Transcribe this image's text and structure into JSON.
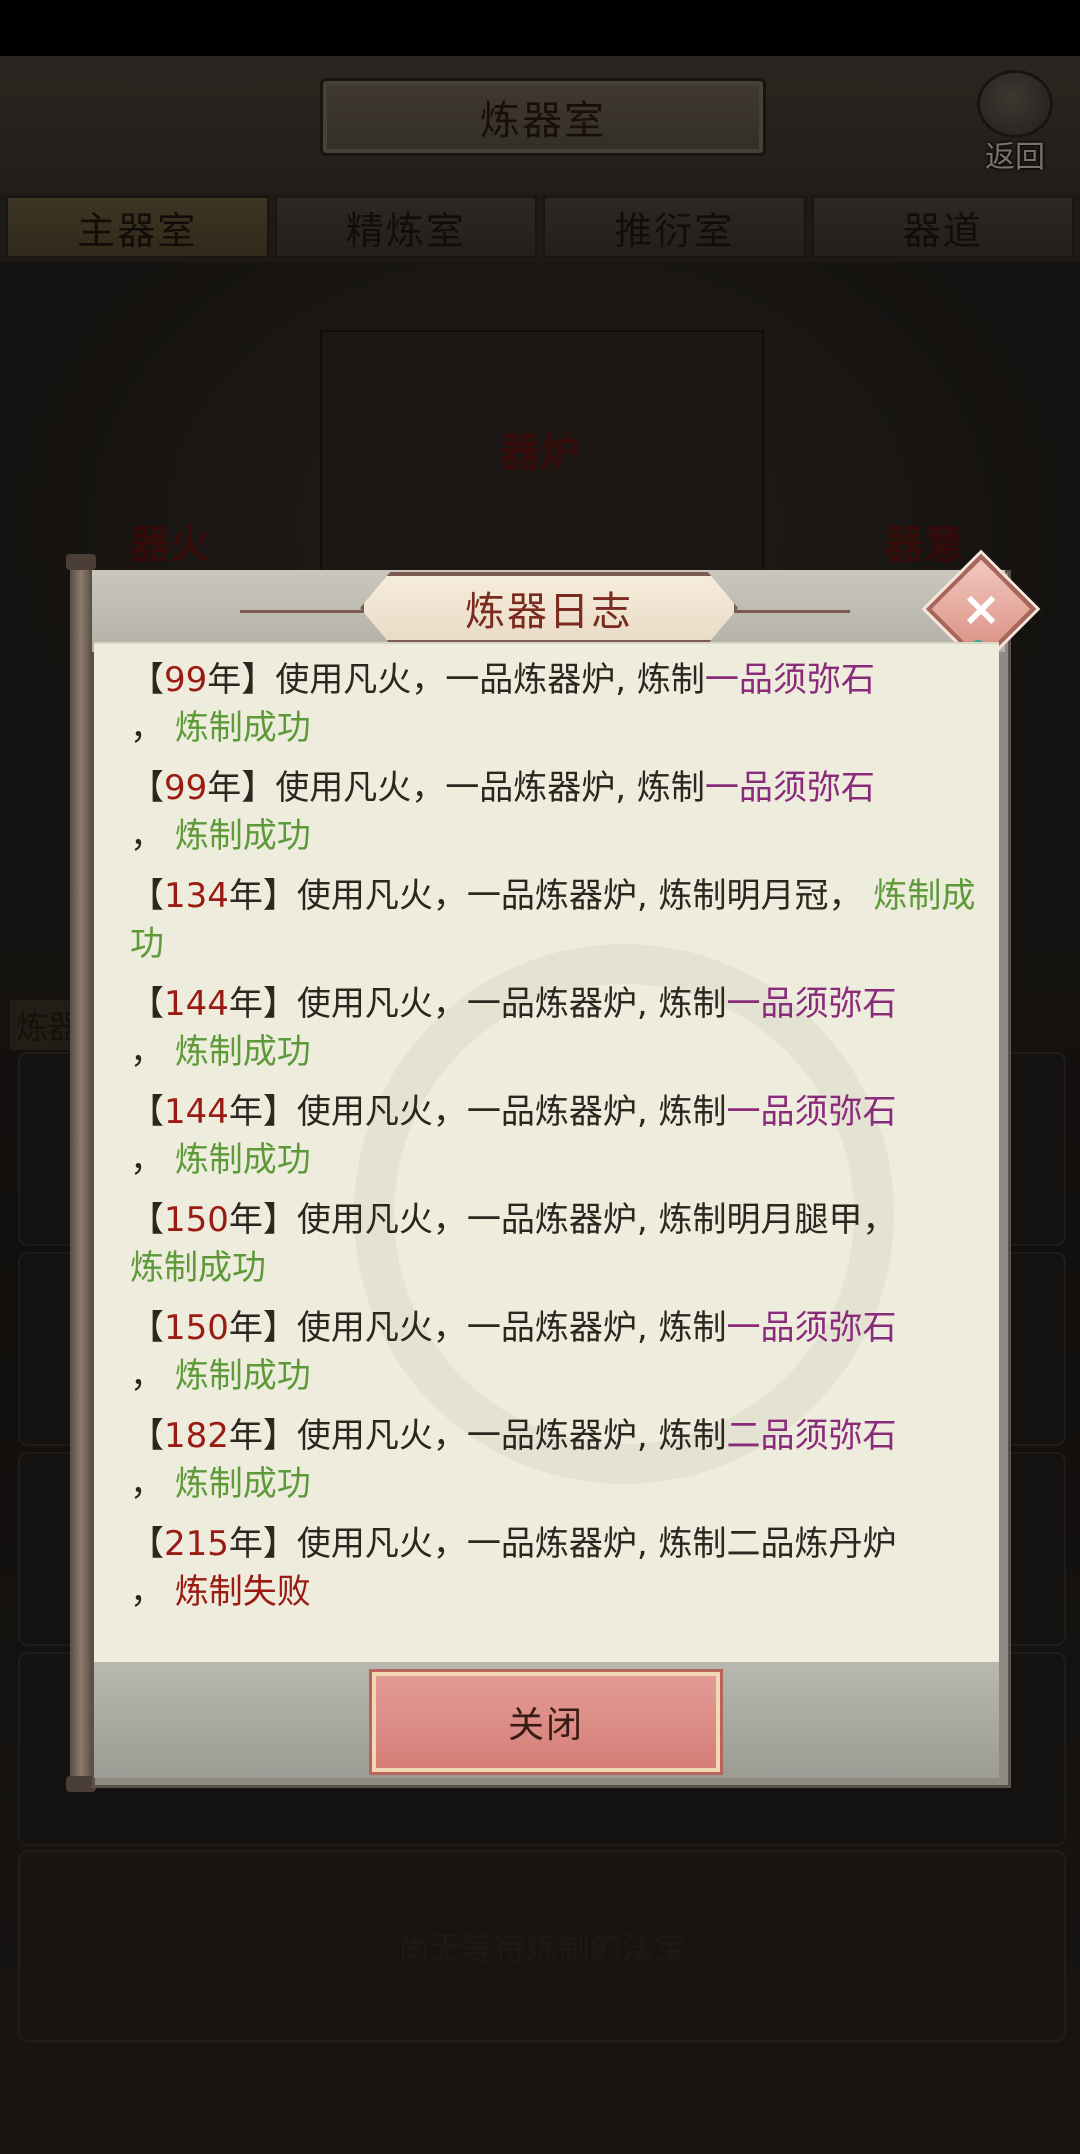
{
  "header": {
    "title": "炼器室",
    "back_label": "返回"
  },
  "tabs": [
    {
      "label": "主器室"
    },
    {
      "label": "精炼室"
    },
    {
      "label": "推衍室"
    },
    {
      "label": "器道"
    }
  ],
  "scene": {
    "furnace_label": "器炉",
    "fire_label": "器火",
    "side_label_right": "器意",
    "side_tab_label": "炼器",
    "empty_queue_text": "尚无等待炼制的法宝"
  },
  "dialog": {
    "title": "炼器日志",
    "close_button_label": "关闭",
    "entries": [
      {
        "prefix": "【",
        "year": "99",
        "suffix": "年】使用凡火，一品炼器炉, 炼制",
        "item": "一品须弥石",
        "item_color": "purple",
        "sep": "，",
        "result": "炼制成功",
        "result_type": "ok"
      },
      {
        "prefix": "【",
        "year": "99",
        "suffix": "年】使用凡火，一品炼器炉, 炼制",
        "item": "一品须弥石",
        "item_color": "purple",
        "sep": "，",
        "result": "炼制成功",
        "result_type": "ok"
      },
      {
        "prefix": "【",
        "year": "134",
        "suffix": "年】使用凡火，一品炼器炉, 炼制",
        "item": "明月冠",
        "item_color": "plain",
        "sep": "，",
        "result": "炼制成功",
        "result_type": "ok"
      },
      {
        "prefix": "【",
        "year": "144",
        "suffix": "年】使用凡火，一品炼器炉, 炼制",
        "item": "一品须弥石",
        "item_color": "purple",
        "sep": "，",
        "result": "炼制成功",
        "result_type": "ok"
      },
      {
        "prefix": "【",
        "year": "144",
        "suffix": "年】使用凡火，一品炼器炉, 炼制",
        "item": "一品须弥石",
        "item_color": "purple",
        "sep": "，",
        "result": "炼制成功",
        "result_type": "ok"
      },
      {
        "prefix": "【",
        "year": "150",
        "suffix": "年】使用凡火，一品炼器炉, 炼制",
        "item": "明月腿甲",
        "item_color": "plain",
        "sep": "，",
        "result": "炼制成功",
        "result_type": "ok"
      },
      {
        "prefix": "【",
        "year": "150",
        "suffix": "年】使用凡火，一品炼器炉, 炼制",
        "item": "一品须弥石",
        "item_color": "purple",
        "sep": "，",
        "result": "炼制成功",
        "result_type": "ok"
      },
      {
        "prefix": "【",
        "year": "182",
        "suffix": "年】使用凡火，一品炼器炉, 炼制",
        "item": "二品须弥石",
        "item_color": "purple",
        "sep": "，",
        "result": "炼制成功",
        "result_type": "ok"
      },
      {
        "prefix": "【",
        "year": "215",
        "suffix": "年】使用凡火，一品炼器炉, 炼制",
        "item": "二品炼丹炉",
        "item_color": "plain",
        "sep": "，",
        "result": "炼制失败",
        "result_type": "fail"
      }
    ]
  },
  "colors": {
    "year": "#9a1a14",
    "item_purple": "#8a2a7a",
    "success": "#5e9a3a",
    "failure": "#9a1a14",
    "paper": "#eeecdc"
  }
}
